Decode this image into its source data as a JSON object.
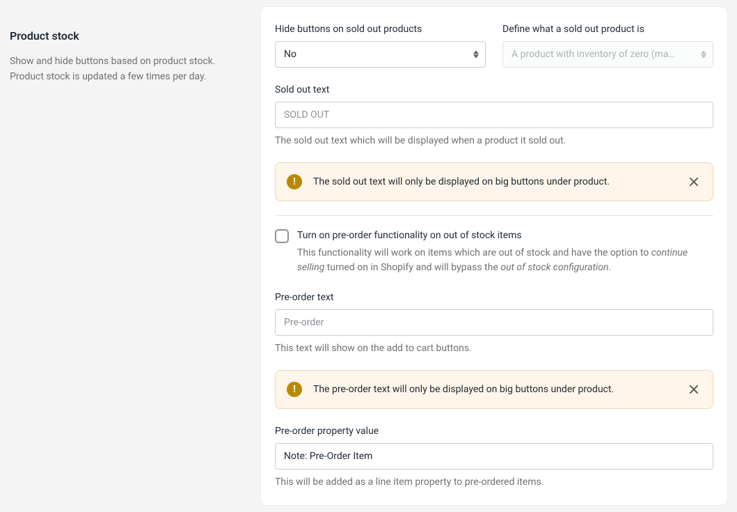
{
  "sidebar": {
    "title": "Product stock",
    "description": "Show and hide buttons based on product stock. Product stock is updated a few times per day."
  },
  "hideButtons": {
    "label": "Hide buttons on sold out products",
    "value": "No"
  },
  "defineSoldOut": {
    "label": "Define what a sold out product is",
    "value": "A product with inventory of zero (ma…"
  },
  "soldOutText": {
    "label": "Sold out text",
    "placeholder": "SOLD OUT",
    "help": "The sold out text which will be displayed when a product it sold out."
  },
  "banner1": {
    "text": "The sold out text will only be displayed on big buttons under product."
  },
  "preorderToggle": {
    "title": "Turn on pre-order functionality on out of stock items",
    "desc_prefix": "This functionality will work on items which are out of stock and have the option to ",
    "desc_em1": "continue selling",
    "desc_mid": " turned on in Shopify and will bypass the ",
    "desc_em2": "out of stock configuration",
    "desc_suffix": "."
  },
  "preorderText": {
    "label": "Pre-order text",
    "placeholder": "Pre-order",
    "help": "This text will show on the add to cart buttons."
  },
  "banner2": {
    "text": "The pre-order text will only be displayed on big buttons under product."
  },
  "preorderProperty": {
    "label": "Pre-order property value",
    "value": "Note: Pre-Order Item",
    "help": "This will be added as a line item property to pre-ordered items."
  }
}
